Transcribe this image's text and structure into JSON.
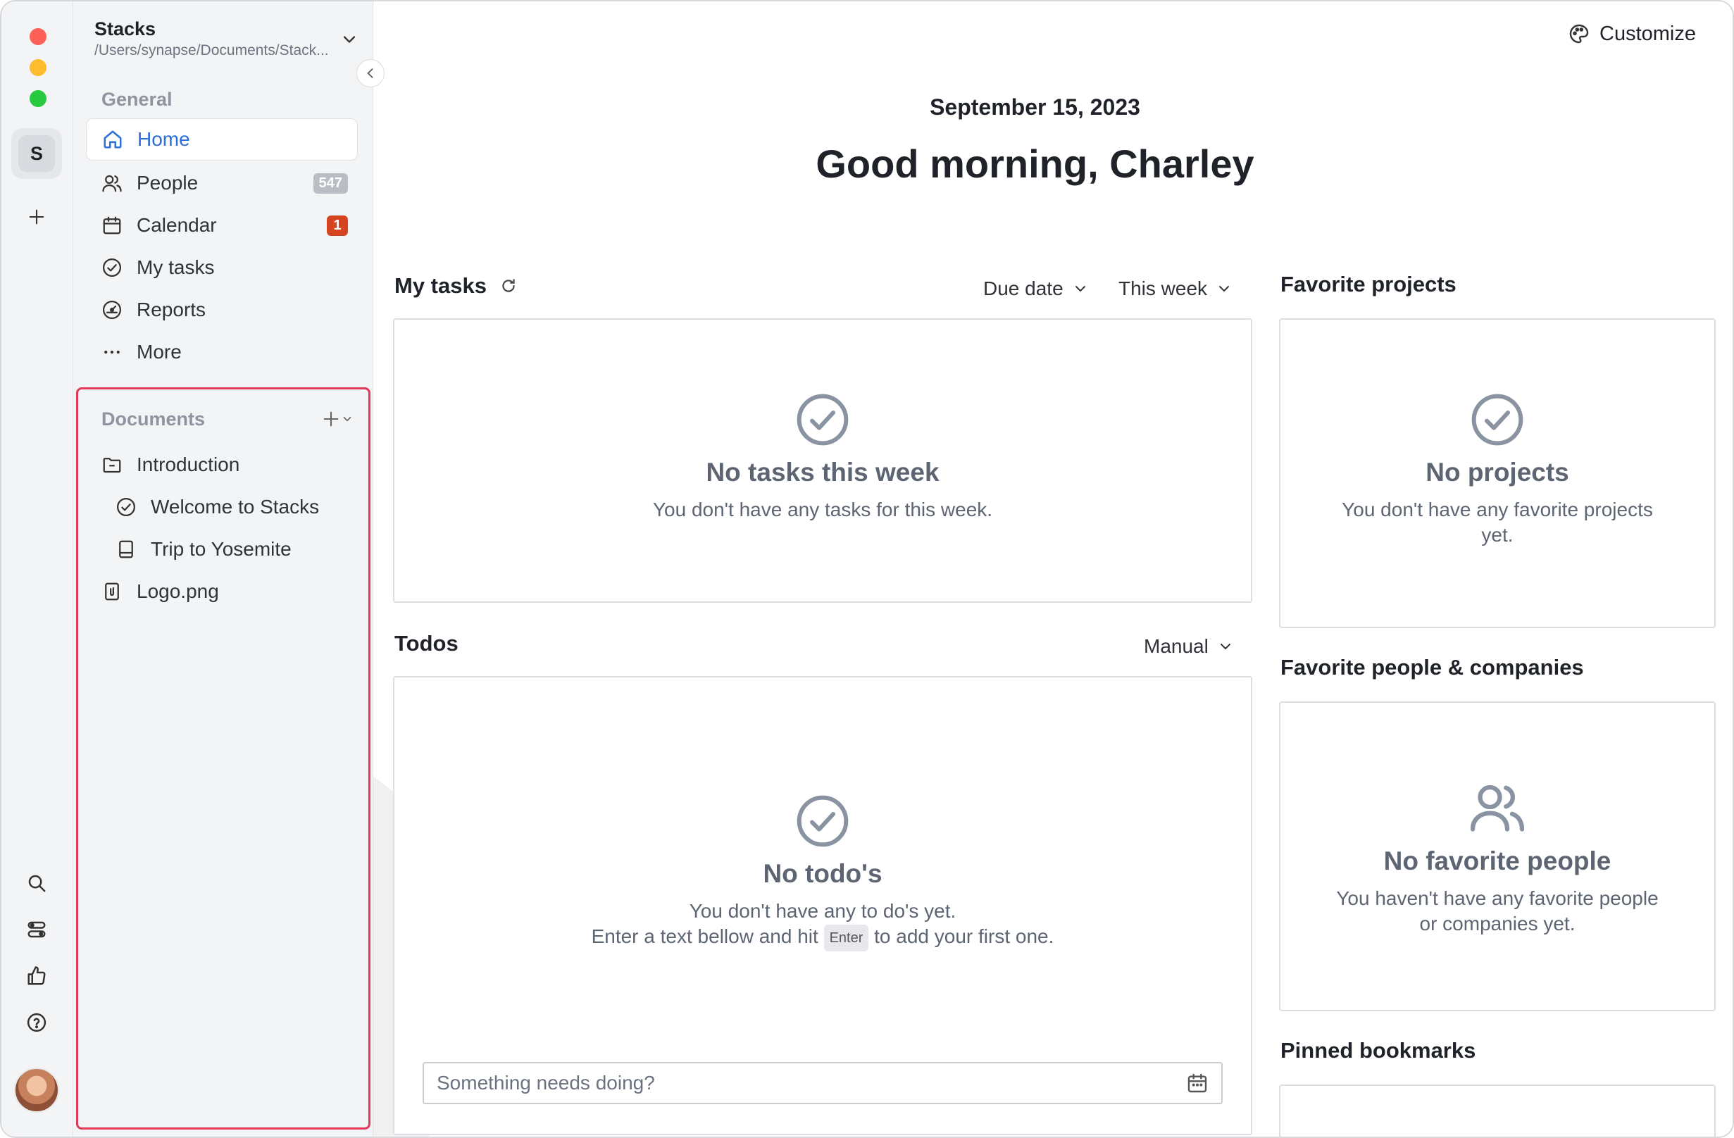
{
  "workspace": {
    "name": "Stacks",
    "path": "/Users/synapse/Documents/Stack...",
    "initial": "S"
  },
  "sidebar": {
    "general_label": "General",
    "items": [
      {
        "label": "Home",
        "icon": "home-icon"
      },
      {
        "label": "People",
        "icon": "people-icon",
        "count": "547"
      },
      {
        "label": "Calendar",
        "icon": "calendar-icon",
        "count": "1"
      },
      {
        "label": "My tasks",
        "icon": "check-circle-icon"
      },
      {
        "label": "Reports",
        "icon": "gauge-icon"
      },
      {
        "label": "More",
        "icon": "ellipsis-icon"
      }
    ],
    "documents_label": "Documents",
    "documents": [
      {
        "label": "Introduction",
        "icon": "folder-icon"
      },
      {
        "label": "Welcome to Stacks",
        "icon": "check-circle-icon"
      },
      {
        "label": "Trip to Yosemite",
        "icon": "book-icon"
      },
      {
        "label": "Logo.png",
        "icon": "attachment-file-icon"
      }
    ]
  },
  "header": {
    "customize_label": "Customize",
    "date": "September 15, 2023",
    "greeting": "Good morning, Charley"
  },
  "my_tasks": {
    "title": "My tasks",
    "sort_label": "Due date",
    "range_label": "This week",
    "empty_title": "No tasks this week",
    "empty_desc": "You don't have any tasks for this week."
  },
  "todos": {
    "title": "Todos",
    "sort_label": "Manual",
    "empty_title": "No todo's",
    "empty_desc_1": "You don't have any to do's yet.",
    "empty_desc_2a": "Enter a text bellow and hit",
    "empty_key": "Enter",
    "empty_desc_2b": "to add your first one.",
    "input_placeholder": "Something needs doing?"
  },
  "favorite_projects": {
    "title": "Favorite projects",
    "empty_title": "No projects",
    "empty_desc": "You don't have any favorite projects yet."
  },
  "favorite_people": {
    "title": "Favorite people & companies",
    "empty_title": "No favorite people",
    "empty_desc": "You haven't have any favorite people or companies yet."
  },
  "pinned_bookmarks": {
    "title": "Pinned bookmarks"
  },
  "colors": {
    "accent": "#2c6fd9",
    "highlight_border": "#e0395a",
    "badge_red": "#d64420"
  }
}
